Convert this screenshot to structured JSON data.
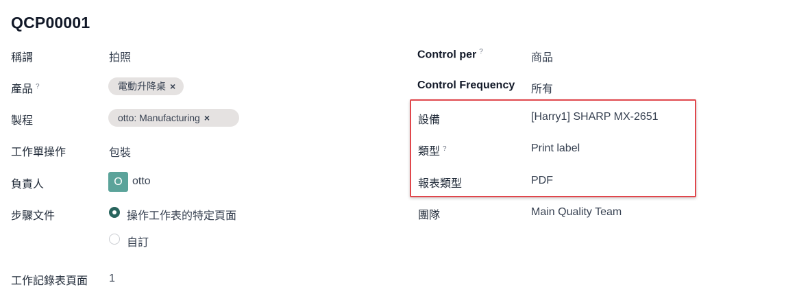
{
  "record": {
    "title": "QCP00001"
  },
  "left_fields": {
    "title_label": "稱謂",
    "title_value": "拍照",
    "product_label": "產品",
    "product_help": "?",
    "product_tag": "電動升降桌",
    "operation_label": "製程",
    "operation_tag": "otto: Manufacturing",
    "work_order_label": "工作單操作",
    "work_order_value": "包裝",
    "responsible_label": "負責人",
    "responsible_initial": "O",
    "responsible_name": "otto",
    "step_doc_label": "步驟文件",
    "step_doc_option_1": "操作工作表的特定頁面",
    "step_doc_option_2": "自訂",
    "worksheet_page_label": "工作記錄表頁面",
    "worksheet_page_value": "1"
  },
  "right_fields": {
    "control_per_label": "Control per",
    "control_per_help": "?",
    "control_per_value": "商品",
    "control_freq_label": "Control Frequency",
    "control_freq_value": "所有",
    "device_label": "設備",
    "device_value": "[Harry1] SHARP MX-2651",
    "type_label": "類型",
    "type_help": "?",
    "type_value": "Print label",
    "report_type_label": "報表類型",
    "report_type_value": "PDF",
    "team_label": "團隊",
    "team_value": "Main Quality Team"
  },
  "colors": {
    "highlight": "#e0474c",
    "avatar": "#5ba39a",
    "radio_selected": "#28645d",
    "tag_bg": "#e5e2e1"
  },
  "icons": {
    "tag_remove": "×"
  }
}
